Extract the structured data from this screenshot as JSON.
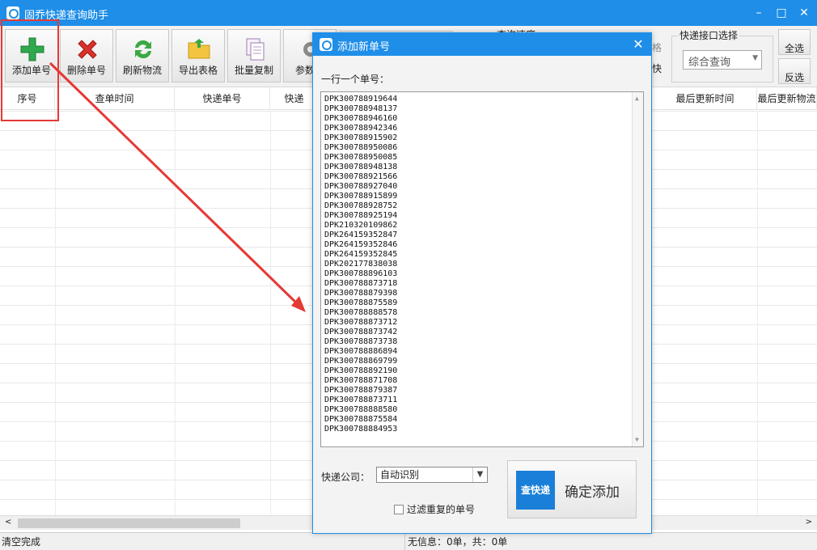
{
  "window": {
    "title": "固乔快递查询助手",
    "minimize": "–",
    "maximize": "□",
    "close": "✕"
  },
  "toolbar": {
    "buttons": [
      {
        "label": "添加单号",
        "icon": "add-icon"
      },
      {
        "label": "删除单号",
        "icon": "delete-icon"
      },
      {
        "label": "刷新物流",
        "icon": "refresh-icon"
      },
      {
        "label": "导出表格",
        "icon": "export-folder-icon"
      },
      {
        "label": "批量复制",
        "icon": "copy-icon"
      },
      {
        "label": "参数设",
        "icon": "settings-gear-icon"
      }
    ],
    "speed_group_fragment": "查询速度",
    "price_fragment": "格",
    "fast_fragment": "快",
    "api_group_label": "快递接口选择",
    "api_selected": "综合查询",
    "select_all": "全选",
    "invert_select": "反选"
  },
  "table": {
    "columns": [
      "序号",
      "查单时间",
      "快递单号",
      "快递",
      "最后更新时间",
      "最后更新物流"
    ]
  },
  "statusbar": {
    "left": "清空完成",
    "right": "无信息：0单，共：0单"
  },
  "dialog": {
    "title": "添加新单号",
    "instruction": "一行一个单号：",
    "numbers": [
      "DPK300788919644",
      "DPK300788948137",
      "DPK300788946160",
      "DPK300788942346",
      "DPK300788915902",
      "DPK300788950086",
      "DPK300788950085",
      "DPK300788948138",
      "DPK300788921566",
      "DPK300788927040",
      "DPK300788915899",
      "DPK300788928752",
      "DPK300788925194",
      "DPK210320109862",
      "DPK264159352847",
      "DPK264159352846",
      "DPK264159352845",
      "DPK202177838038",
      "DPK300788896103",
      "DPK300788873718",
      "DPK300788879398",
      "DPK300788875589",
      "DPK300788888578",
      "DPK300788873712",
      "DPK300788873742",
      "DPK300788873738",
      "DPK300788886894",
      "DPK300788869799",
      "DPK300788892190",
      "DPK300788871708",
      "DPK300788879387",
      "DPK300788873711",
      "DPK300788888580",
      "DPK300788875584",
      "DPK300788884953"
    ],
    "courier_label": "快递公司：",
    "courier_value": "自动识别",
    "confirm_badge": "查快递",
    "confirm_label": "确定添加",
    "filter_label": "过滤重复的单号"
  },
  "colors": {
    "accent": "#1e8ee8",
    "highlight": "#e53935"
  }
}
